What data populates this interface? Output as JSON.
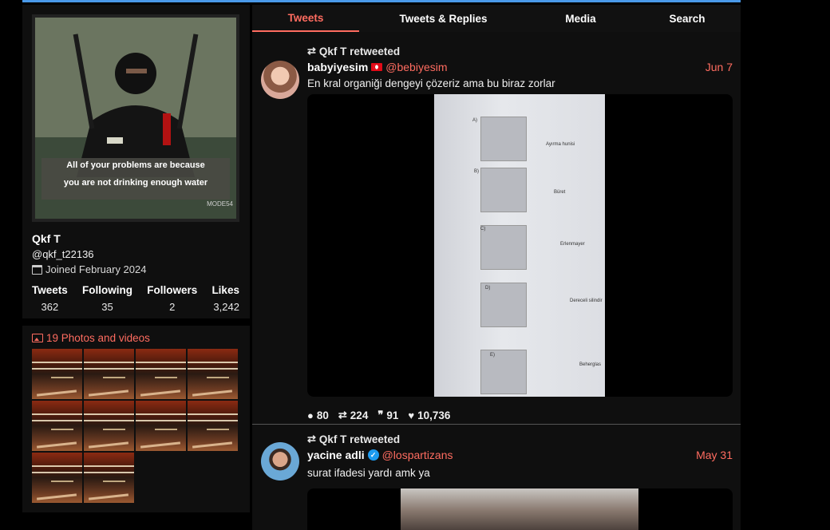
{
  "profile": {
    "fullname": "Qkf T",
    "handle": "@qkf_t22136",
    "joined": "Joined February 2024",
    "banner_caption_1": "All of your problems are because",
    "banner_caption_2": "you are not drinking enough water",
    "banner_watermark": "MODE54",
    "stats": [
      {
        "label": "Tweets",
        "value": "362"
      },
      {
        "label": "Following",
        "value": "35"
      },
      {
        "label": "Followers",
        "value": "2"
      },
      {
        "label": "Likes",
        "value": "3,242"
      }
    ]
  },
  "photo_rail": {
    "title": "19 Photos and videos",
    "thumbnail_count": 10
  },
  "tabs": [
    {
      "label": "Tweets",
      "active": true
    },
    {
      "label": "Tweets & Replies",
      "active": false
    },
    {
      "label": "Media",
      "active": false
    },
    {
      "label": "Search",
      "active": false
    }
  ],
  "tweets": [
    {
      "retweet_label": "Qkf T retweeted",
      "name": "babyiyesim",
      "handle": "@bebiyesim",
      "date": "Jun 7",
      "text": "En kral organiği dengeyi çözeriz ama bu biraz zorlar",
      "stats": {
        "replies": "80",
        "retweets": "224",
        "quotes": "91",
        "likes": "10,736"
      },
      "image_labels": [
        "A)",
        "B)",
        "C)",
        "D)",
        "E)",
        "Ayırma hunisi",
        "Büret",
        "Erlenmayer",
        "Dereceli silindir",
        "Beherglas"
      ]
    },
    {
      "retweet_label": "Qkf T retweeted",
      "name": "yacine adli",
      "handle": "@lospartizans",
      "date": "May 31",
      "text": "surat ifadesi yardı amk ya"
    }
  ],
  "colors": {
    "accent": "#ff6c60",
    "topline": "#4a99e9",
    "panel": "#0f0f0f"
  },
  "icons": {
    "calendar": "calendar-icon",
    "photos": "image-icon",
    "retweet": "retweet-icon",
    "reply": "comment-icon",
    "quote": "quote-icon",
    "like": "heart-icon",
    "verified": "verified-badge-icon"
  }
}
